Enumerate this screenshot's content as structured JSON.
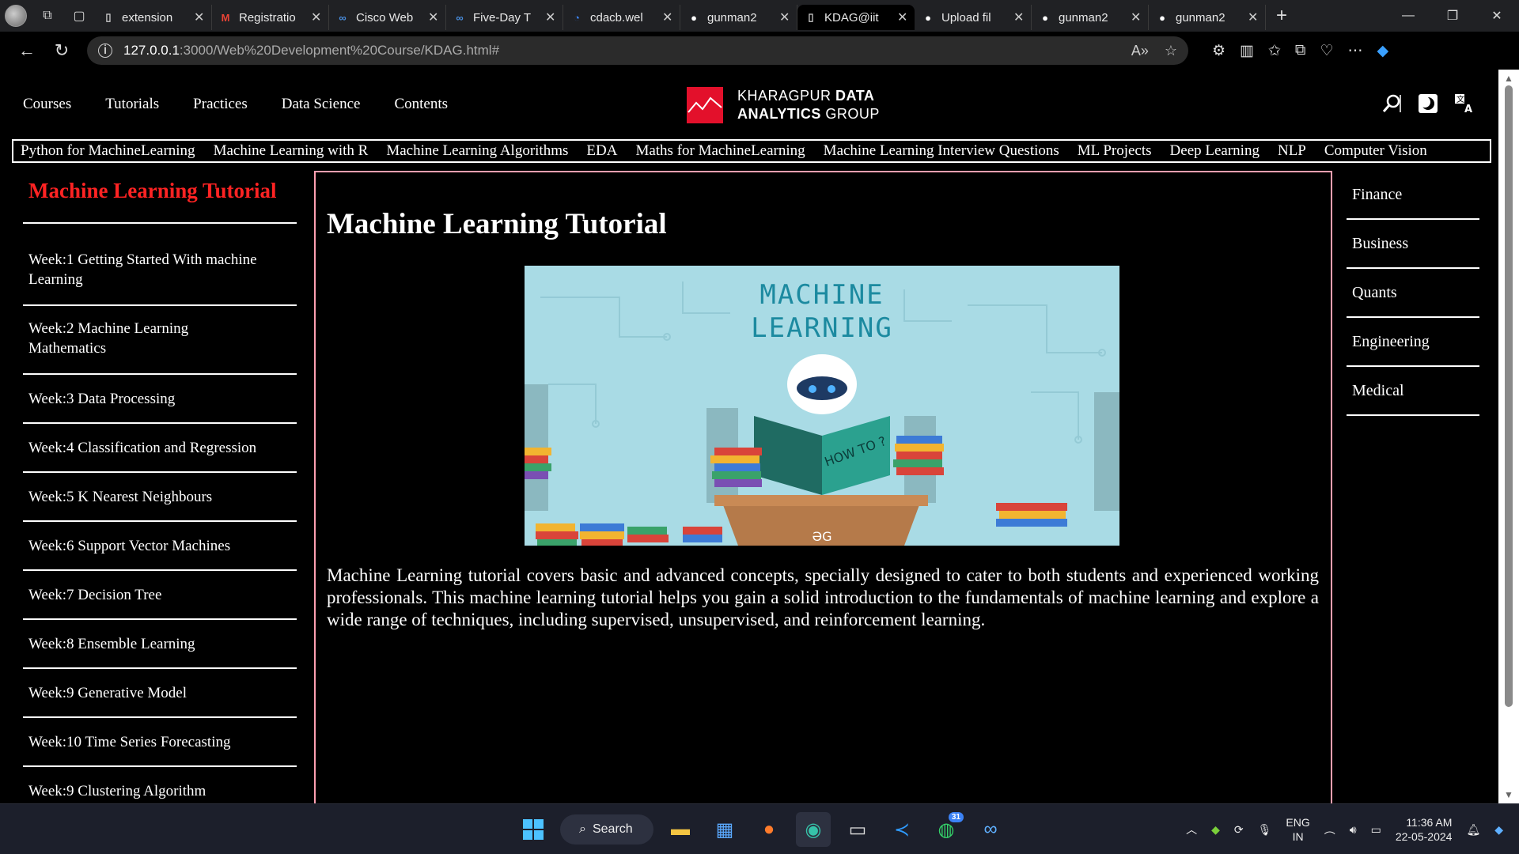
{
  "browser": {
    "tabs": [
      {
        "label": "extension",
        "icon": "document-icon",
        "color": "#cccccc"
      },
      {
        "label": "Registratio",
        "icon": "gmail-icon",
        "color": "#ea4335"
      },
      {
        "label": "Cisco Web",
        "icon": "webex-icon",
        "color": "#4a90e2"
      },
      {
        "label": "Five-Day T",
        "icon": "webex-icon",
        "color": "#4a90e2"
      },
      {
        "label": "cdacb.wel",
        "icon": "webpage-icon",
        "color": "#3b82f6"
      },
      {
        "label": "gunman2",
        "icon": "github-icon",
        "color": "#ffffff"
      },
      {
        "label": "KDAG@iit",
        "icon": "document-icon",
        "color": "#cccccc"
      },
      {
        "label": "Upload fil",
        "icon": "github-icon",
        "color": "#ffffff"
      },
      {
        "label": "gunman2",
        "icon": "github-icon",
        "color": "#ffffff"
      },
      {
        "label": "gunman2",
        "icon": "github-icon",
        "color": "#ffffff"
      }
    ],
    "active_tab_index": 6,
    "url_host": "127.0.0.1",
    "url_path": ":3000/Web%20Development%20Course/KDAG.html#"
  },
  "site": {
    "nav_links": [
      "Courses",
      "Tutorials",
      "Practices",
      "Data Science",
      "Contents"
    ],
    "brand_line1_light": "KHARAGPUR ",
    "brand_line1_bold": "DATA",
    "brand_line2_bold": "ANALYTICS ",
    "brand_line2_light": "GROUP",
    "subnav": [
      "Python for MachineLearning",
      "Machine Learning with R",
      "Machine Learning Algorithms",
      "EDA",
      "Maths for MachineLearning",
      "Machine Learning Interview Questions",
      "ML Projects",
      "Deep Learning",
      "NLP",
      "Computer Vision"
    ],
    "accent_red": "#ff2323",
    "main_border_color": "#ff9fb0"
  },
  "sidebar": {
    "title": "Machine Learning Tutorial",
    "weeks": [
      {
        "line1": "Week:1 Getting Started With machine",
        "line2": "Learning"
      },
      {
        "line1": "Week:2 Machine Learning",
        "line2": "Mathematics"
      },
      {
        "line1": "Week:3 Data Processing",
        "line2": ""
      },
      {
        "line1": "Week:4 Classification and Regression",
        "line2": ""
      },
      {
        "line1": "Week:5 K Nearest Neighbours",
        "line2": ""
      },
      {
        "line1": "Week:6 Support Vector Machines",
        "line2": ""
      },
      {
        "line1": "Week:7 Decision Tree",
        "line2": ""
      },
      {
        "line1": "Week:8 Ensemble Learning",
        "line2": ""
      },
      {
        "line1": "Week:9 Generative Model",
        "line2": ""
      },
      {
        "line1": "Week:10 Time Series Forecasting",
        "line2": ""
      },
      {
        "line1": "Week:9 Clustering Algorithm",
        "line2": ""
      }
    ]
  },
  "main": {
    "heading": "Machine Learning Tutorial",
    "hero_line1": "MACHINE",
    "hero_line2": "LEARNING",
    "hero_book_text": "HOW TO ?",
    "hero_logo": "ƏG",
    "paragraph": "Machine Learning tutorial covers basic and advanced concepts, specially designed to cater to both students and experienced working professionals. This machine learning tutorial helps you gain a solid introduction to the fundamentals of machine learning and explore a wide range of techniques, including supervised, unsupervised, and reinforcement learning."
  },
  "right_sidebar": {
    "items": [
      "Finance",
      "Business",
      "Quants",
      "Engineering",
      "Medical"
    ]
  },
  "taskbar": {
    "search_label": "Search",
    "whatsapp_badge": "31",
    "lang_line1": "ENG",
    "lang_line2": "IN",
    "time": "11:36 AM",
    "date": "22-05-2024"
  }
}
